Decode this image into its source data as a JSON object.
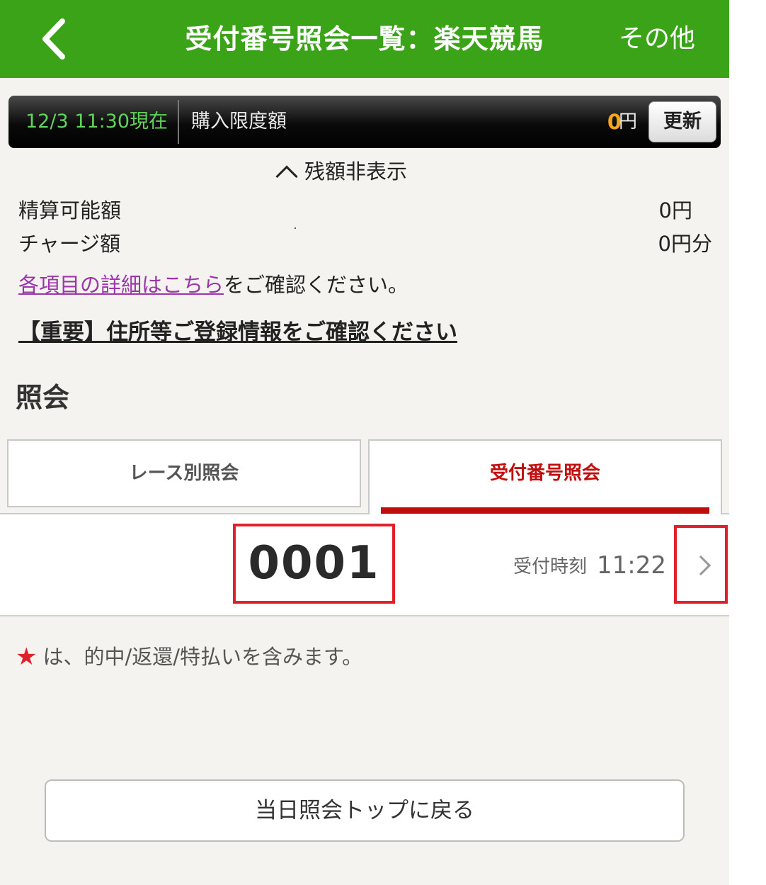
{
  "header": {
    "title": "受付番号照会一覧：楽天競馬",
    "other_label": "その他",
    "back_icon": "chevron-left-icon",
    "color": "#3aa318"
  },
  "balance": {
    "time": "12/3 11:30現在",
    "label": "購入限度額",
    "amount": "0",
    "unit": "円",
    "refresh_label": "更新",
    "amount_color": "#f4a51c"
  },
  "toggle": {
    "label": "残額非表示",
    "icon": "chevron-up-icon"
  },
  "rows": [
    {
      "label": "精算可能額",
      "value": "0円"
    },
    {
      "label": "チャージ額",
      "value": "0円分"
    }
  ],
  "info": {
    "link_text": "各項目の詳細はこちら",
    "suffix": "をご確認ください。"
  },
  "important_link": "【重要】住所等ご登録情報をご確認ください",
  "section_title": "照会",
  "tabs": [
    {
      "label": "レース別照会",
      "active": false
    },
    {
      "label": "受付番号照会",
      "active": true
    }
  ],
  "receipt": {
    "number": "0001",
    "time_label": "受付時刻",
    "time": "11:22",
    "icon": "chevron-right-icon",
    "highlight_color": "#e0202a"
  },
  "note": {
    "icon": "star-icon",
    "text": "は、的中/返還/特払いを含みます。"
  },
  "back_top_label": "当日照会トップに戻る"
}
